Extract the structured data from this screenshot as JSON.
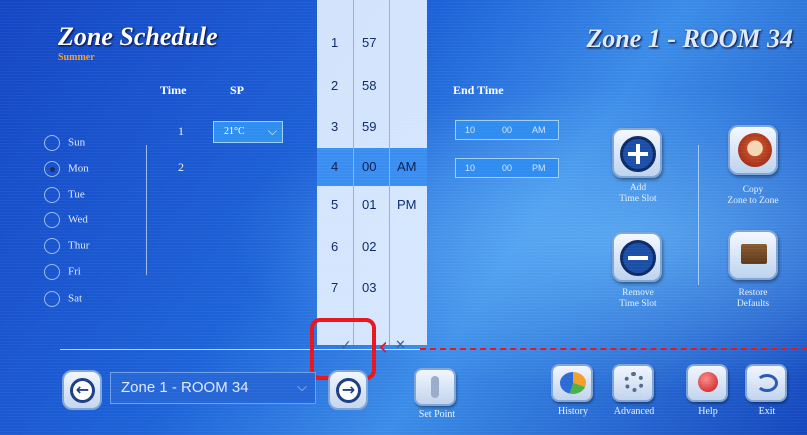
{
  "header": {
    "title": "Zone Schedule",
    "subtitle": "Summer",
    "zone_title": "Zone 1 - ROOM 34"
  },
  "table": {
    "col_time": "Time",
    "col_sp": "SP",
    "col_end": "End Time",
    "rows": [
      {
        "num": "1",
        "sp": "21°C",
        "end_hour": "10",
        "end_min": "00",
        "end_ampm": "AM"
      },
      {
        "num": "2",
        "end_hour": "10",
        "end_min": "00",
        "end_ampm": "PM"
      }
    ]
  },
  "days": [
    {
      "label": "Sun",
      "selected": false
    },
    {
      "label": "Mon",
      "selected": true
    },
    {
      "label": "Tue",
      "selected": false
    },
    {
      "label": "Wed",
      "selected": false
    },
    {
      "label": "Thur",
      "selected": false
    },
    {
      "label": "Fri",
      "selected": false
    },
    {
      "label": "Sat",
      "selected": false
    }
  ],
  "picker": {
    "hours": [
      "1",
      "2",
      "3",
      "4",
      "5",
      "6",
      "7"
    ],
    "minutes": [
      "57",
      "58",
      "59",
      "00",
      "01",
      "02",
      "03"
    ],
    "ampm_am": "AM",
    "ampm_pm": "PM",
    "selected_hour": "4",
    "selected_minute": "00",
    "selected_ampm": "AM"
  },
  "actions": {
    "add_slot_l1": "Add",
    "add_slot_l2": "Time Slot",
    "copy_zone_l1": "Copy",
    "copy_zone_l2": "Zone to Zone",
    "remove_slot_l1": "Remove",
    "remove_slot_l2": "Time Slot",
    "restore_l1": "Restore",
    "restore_l2": "Defaults"
  },
  "footer": {
    "zone_select": "Zone 1 - ROOM 34",
    "setpoint": "Set Point",
    "history": "History",
    "advanced": "Advanced",
    "help": "Help",
    "exit": "Exit"
  },
  "colors": {
    "annotation_red": "#e8141e",
    "picker_highlight": "#3a8ef2",
    "background_blue": "#1d62d8"
  }
}
